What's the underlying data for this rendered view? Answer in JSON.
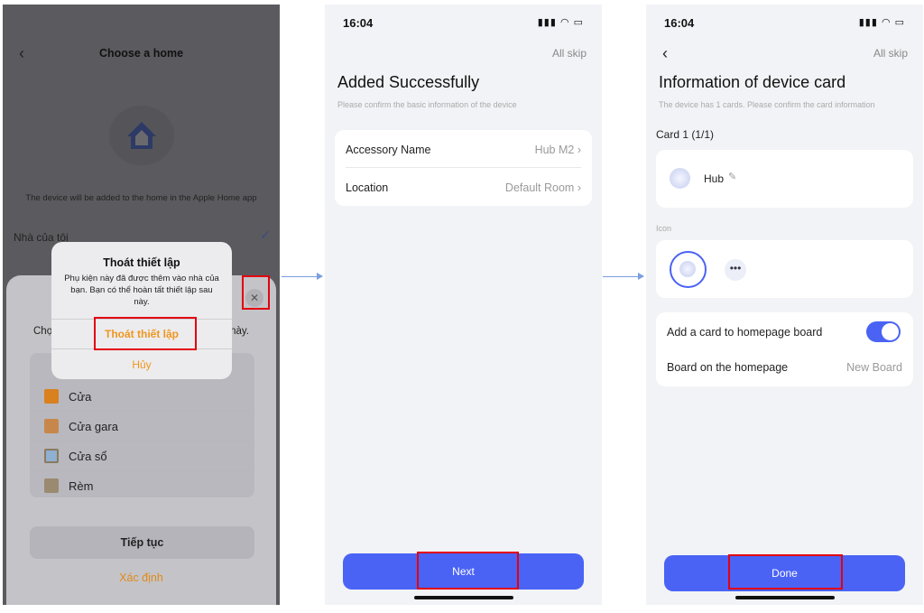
{
  "panel1": {
    "title": "Choose a home",
    "back_icon": "chevron-left-icon",
    "home_icon": "house-icon",
    "description": "The device will be added to the home in the Apple Home app",
    "home_name": "Nhà của tôi",
    "sheet_prompt_left": "Chọ",
    "sheet_prompt_right": "này.",
    "categories": [
      {
        "label": "Cửa",
        "color": "#d9801f"
      },
      {
        "label": "Cửa gara",
        "color": "#c8874a"
      },
      {
        "label": "Cửa sổ",
        "color": "#8fb0d0"
      },
      {
        "label": "Rèm",
        "color": "#9a8a70"
      }
    ],
    "continue_label": "Tiếp tục",
    "confirm_label": "Xác định",
    "alert": {
      "title": "Thoát thiết lập",
      "message": "Phụ kiện này đã được thêm vào nhà của bạn. Bạn có thể hoàn tất thiết lập sau này.",
      "exit_label": "Thoát thiết lập",
      "cancel_label": "Hủy"
    }
  },
  "panel2": {
    "time": "16:04",
    "skip": "All skip",
    "title": "Added Successfully",
    "subtitle": "Please confirm the basic information of the device",
    "rows": [
      {
        "label": "Accessory Name",
        "value": "Hub M2"
      },
      {
        "label": "Location",
        "value": "Default Room"
      }
    ],
    "next_label": "Next"
  },
  "panel3": {
    "time": "16:04",
    "skip": "All skip",
    "title": "Information of device card",
    "subtitle": "The device has 1 cards. Please confirm the card information",
    "card_label": "Card 1 (1/1)",
    "device_name": "Hub",
    "icon_label": "Icon",
    "toggle_label": "Add a card to homepage board",
    "toggle_on": true,
    "board_label": "Board on the homepage",
    "board_value": "New Board",
    "done_label": "Done"
  },
  "colors": {
    "accent": "#4a63f5",
    "alert_orange": "#f0961e",
    "highlight": "#e3000f"
  }
}
